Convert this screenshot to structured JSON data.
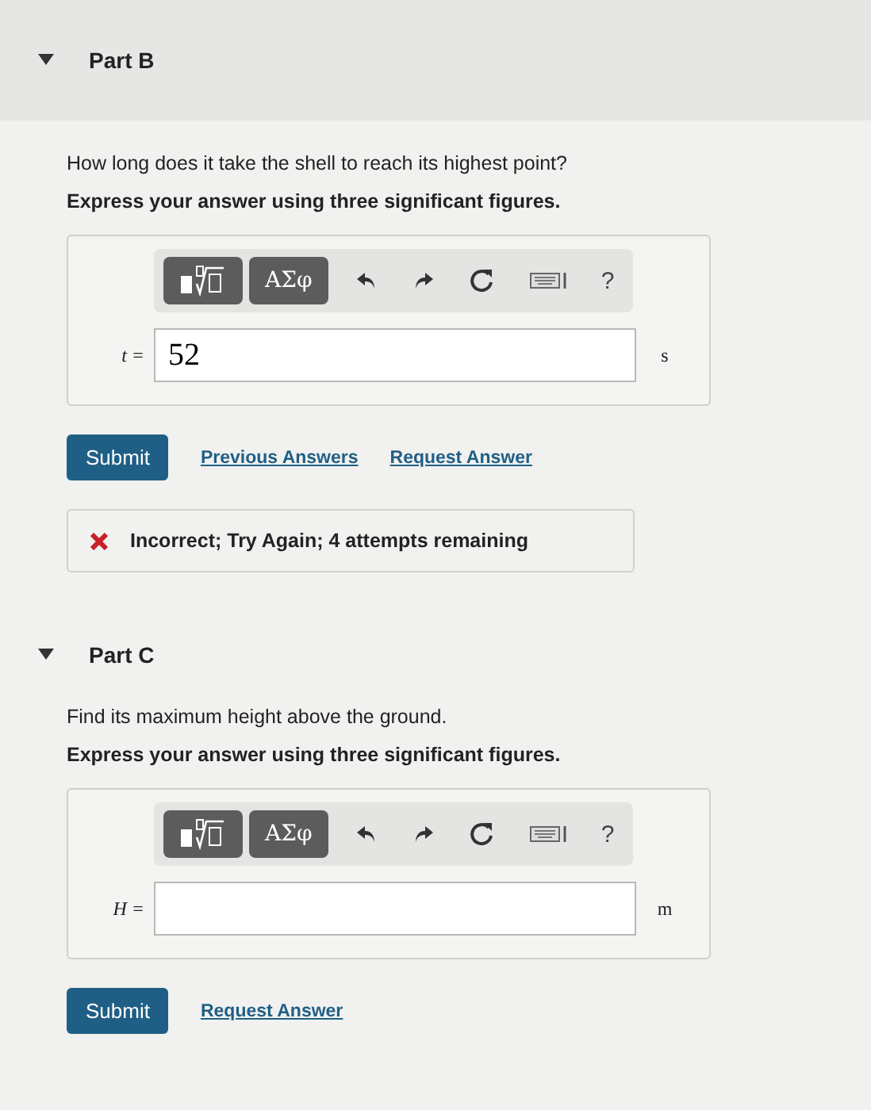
{
  "parts": [
    {
      "title": "Part B",
      "expanded": true,
      "question": "How long does it take the shell to reach its highest point?",
      "instruction": "Express your answer using three significant figures.",
      "toolbar": {
        "symbols": "ΑΣφ",
        "help": "?"
      },
      "variable": "t =",
      "value": "52",
      "unit": "s",
      "submit": "Submit",
      "links": [
        "Previous Answers",
        "Request Answer"
      ],
      "feedback": "Incorrect; Try Again; 4 attempts remaining"
    },
    {
      "title": "Part C",
      "expanded": true,
      "question": "Find its maximum height above the ground.",
      "instruction": "Express your answer using three significant figures.",
      "toolbar": {
        "symbols": "ΑΣφ",
        "help": "?"
      },
      "variable": "H =",
      "unit": "m",
      "submit": "Submit",
      "links": [
        "Request Answer"
      ]
    }
  ]
}
